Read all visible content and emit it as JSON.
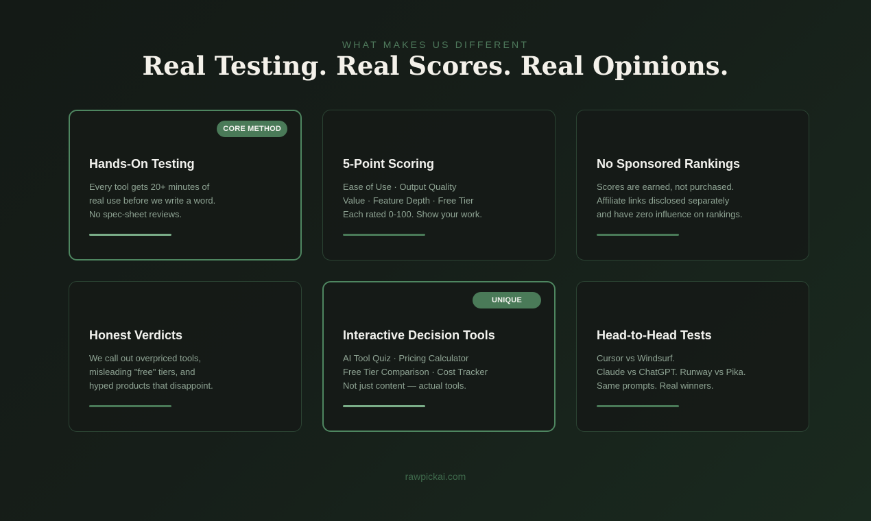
{
  "header": {
    "eyebrow": "WHAT MAKES US DIFFERENT",
    "title": "Real Testing. Real Scores. Real Opinions."
  },
  "cards": [
    {
      "badge": "CORE METHOD",
      "title": "Hands-On Testing",
      "lines": [
        "Every tool gets 20+ minutes of",
        "real use before we write a word.",
        "No spec-sheet reviews."
      ]
    },
    {
      "badge": "",
      "title": "5-Point Scoring",
      "lines": [
        "Ease of Use · Output Quality",
        "Value · Feature Depth · Free Tier",
        "Each rated 0-100. Show your work."
      ]
    },
    {
      "badge": "",
      "title": "No Sponsored Rankings",
      "lines": [
        "Scores are earned, not purchased.",
        "Affiliate links disclosed separately",
        "and have zero influence on rankings."
      ]
    },
    {
      "badge": "",
      "title": "Honest Verdicts",
      "lines": [
        "We call out overpriced tools,",
        "misleading \"free\" tiers, and",
        "hyped products that disappoint."
      ]
    },
    {
      "badge": "UNIQUE",
      "title": "Interactive Decision Tools",
      "lines": [
        "AI Tool Quiz · Pricing Calculator",
        "Free Tier Comparison · Cost Tracker",
        "Not just content — actual tools."
      ]
    },
    {
      "badge": "",
      "title": "Head-to-Head Tests",
      "lines": [
        "Cursor vs Windsurf.",
        "Claude vs ChatGPT. Runway vs Pika.",
        "Same prompts. Real winners."
      ]
    }
  ],
  "footer": {
    "site": "rawpickai.com"
  },
  "colors": {
    "background": "#161e19",
    "accent": "#4a7a58",
    "accent_light": "#7aad88",
    "title_text": "#f4f1ea",
    "body_text": "#8ea393"
  }
}
